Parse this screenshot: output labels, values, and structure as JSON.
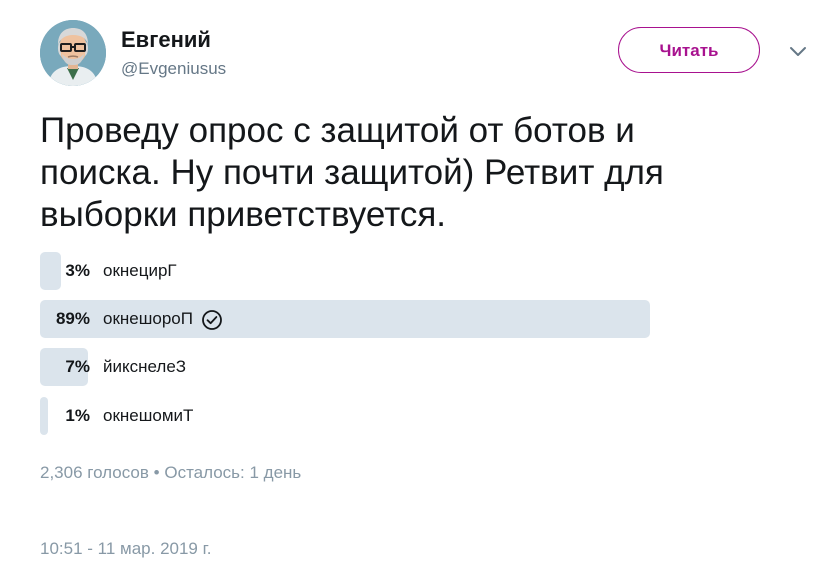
{
  "user": {
    "name": "Евгений",
    "handle": "@Evgeniusus"
  },
  "follow_button_label": "Читать",
  "tweet": {
    "text_lines": [
      "Проведу опрос с защитой от ботов и",
      "поиска. Ну почти защитой) Ретвит для",
      "выборки приветствуется."
    ]
  },
  "poll": {
    "options": [
      {
        "percent_label": "3%",
        "percent": 3,
        "label": "окнецирГ",
        "winner": false
      },
      {
        "percent_label": "89%",
        "percent": 89,
        "label": "окнешороП",
        "winner": true
      },
      {
        "percent_label": "7%",
        "percent": 7,
        "label": "йикснелеЗ",
        "winner": false
      },
      {
        "percent_label": "1%",
        "percent": 1,
        "label": "окнешомиТ",
        "winner": false
      }
    ],
    "votes": "2,306 голосов",
    "separator": "•",
    "remaining": "Осталось: 1 день"
  },
  "timestamp": "10:51 - 11 мар. 2019 г.",
  "colors": {
    "accent": "#a8128f",
    "poll_bar": "#dbe4ec",
    "muted_text": "#8899a6"
  },
  "icons": {
    "chevron": "chevron-down-icon",
    "check": "check-circle-icon",
    "avatar": "avatar-portrait"
  }
}
